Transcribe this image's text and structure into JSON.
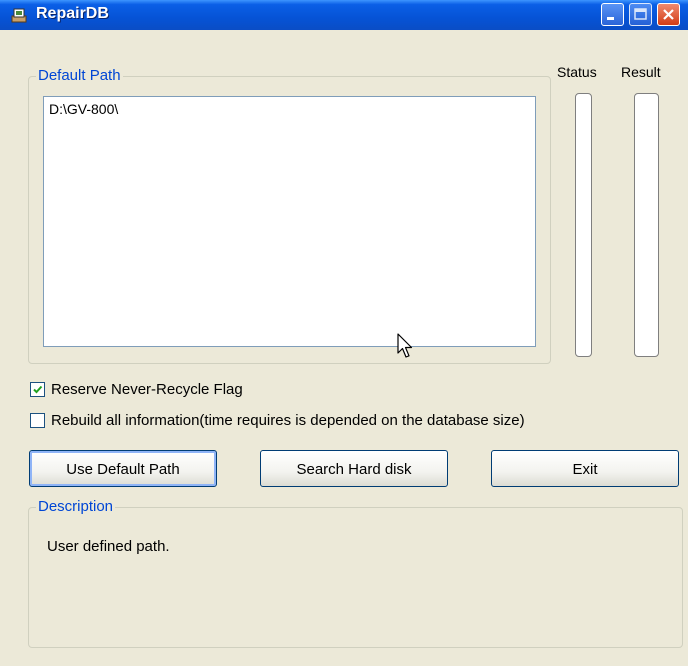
{
  "window": {
    "title": "RepairDB",
    "icons": [
      "app-icon",
      "minimize-icon",
      "maximize-icon",
      "close-icon"
    ]
  },
  "path_group": {
    "label": "Default Path",
    "paths": [
      "D:\\GV-800\\"
    ]
  },
  "columns": {
    "status_label": "Status",
    "result_label": "Result"
  },
  "options": {
    "reserve_flag": {
      "label": "Reserve Never-Recycle Flag",
      "checked": true
    },
    "rebuild_all": {
      "label": "Rebuild all information(time requires is depended on the database size)",
      "checked": false
    }
  },
  "buttons": {
    "use_default_path": "Use Default Path",
    "search_hard_disk": "Search Hard disk",
    "exit": "Exit"
  },
  "description": {
    "label": "Description",
    "text": "User defined path."
  },
  "colors": {
    "titlebar": "#0653d6",
    "window_bg": "#ece9d8",
    "group_label": "#0046d5",
    "close_button": "#d23c16"
  }
}
